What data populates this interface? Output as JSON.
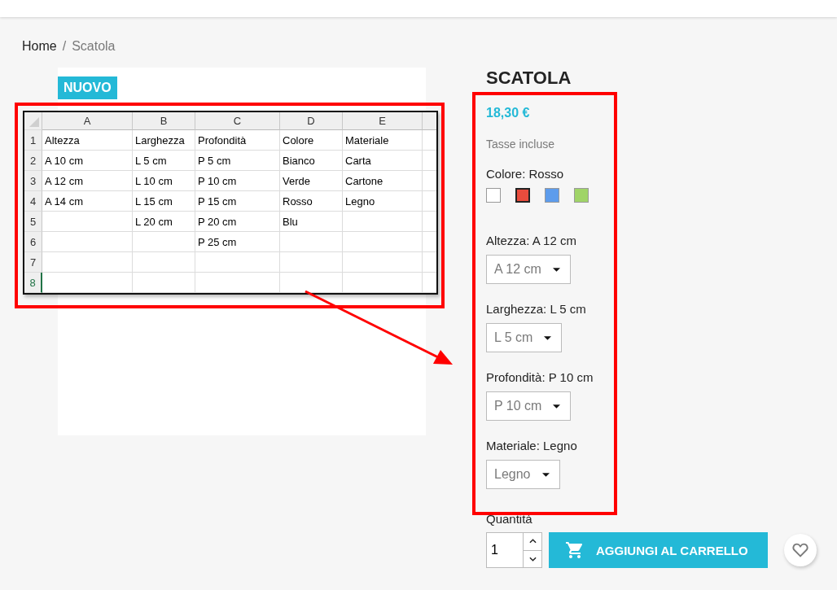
{
  "breadcrumb": {
    "separator": "/",
    "items": [
      {
        "label": "Home"
      },
      {
        "label": "Scatola"
      }
    ]
  },
  "badge": "NUOVO",
  "spreadsheet": {
    "columns": [
      "A",
      "B",
      "C",
      "D",
      "E"
    ],
    "rows": [
      {
        "number": "1",
        "selected": false,
        "cells": [
          "Altezza",
          "Larghezza",
          "Profondità",
          "Colore",
          "Materiale"
        ]
      },
      {
        "number": "2",
        "selected": false,
        "cells": [
          "A 10 cm",
          "L 5 cm",
          "P 5 cm",
          "Bianco",
          "Carta"
        ]
      },
      {
        "number": "3",
        "selected": false,
        "cells": [
          "A 12 cm",
          "L 10 cm",
          "P 10 cm",
          "Verde",
          "Cartone"
        ]
      },
      {
        "number": "4",
        "selected": false,
        "cells": [
          "A 14 cm",
          "L 15 cm",
          "P 15 cm",
          "Rosso",
          "Legno"
        ]
      },
      {
        "number": "5",
        "selected": false,
        "cells": [
          "",
          "L 20 cm",
          "P 20 cm",
          "Blu",
          ""
        ]
      },
      {
        "number": "6",
        "selected": false,
        "cells": [
          "",
          "",
          "P 25 cm",
          "",
          ""
        ]
      },
      {
        "number": "7",
        "selected": false,
        "cells": [
          "",
          "",
          "",
          "",
          ""
        ]
      },
      {
        "number": "8",
        "selected": true,
        "cells": [
          "",
          "",
          "",
          "",
          ""
        ]
      }
    ]
  },
  "product": {
    "title": "SCATOLA",
    "price": "18,30 €",
    "tax_note": "Tasse incluse",
    "color_label": "Colore: Rosso",
    "swatches": [
      {
        "color": "#ffffff",
        "selected": false
      },
      {
        "color": "#e84c3d",
        "selected": true
      },
      {
        "color": "#5d9cec",
        "selected": false
      },
      {
        "color": "#a0d468",
        "selected": false
      }
    ],
    "selects": [
      {
        "label": "Altezza: A 12 cm",
        "value": "A 12 cm"
      },
      {
        "label": "Larghezza: L 5 cm",
        "value": "L 5 cm"
      },
      {
        "label": "Profondità: P 10 cm",
        "value": "P 10 cm"
      },
      {
        "label": "Materiale: Legno",
        "value": "Legno"
      }
    ],
    "quantity": {
      "label": "Quantità",
      "value": "1"
    },
    "add_to_cart": "AGGIUNGI AL CARRELLO"
  }
}
